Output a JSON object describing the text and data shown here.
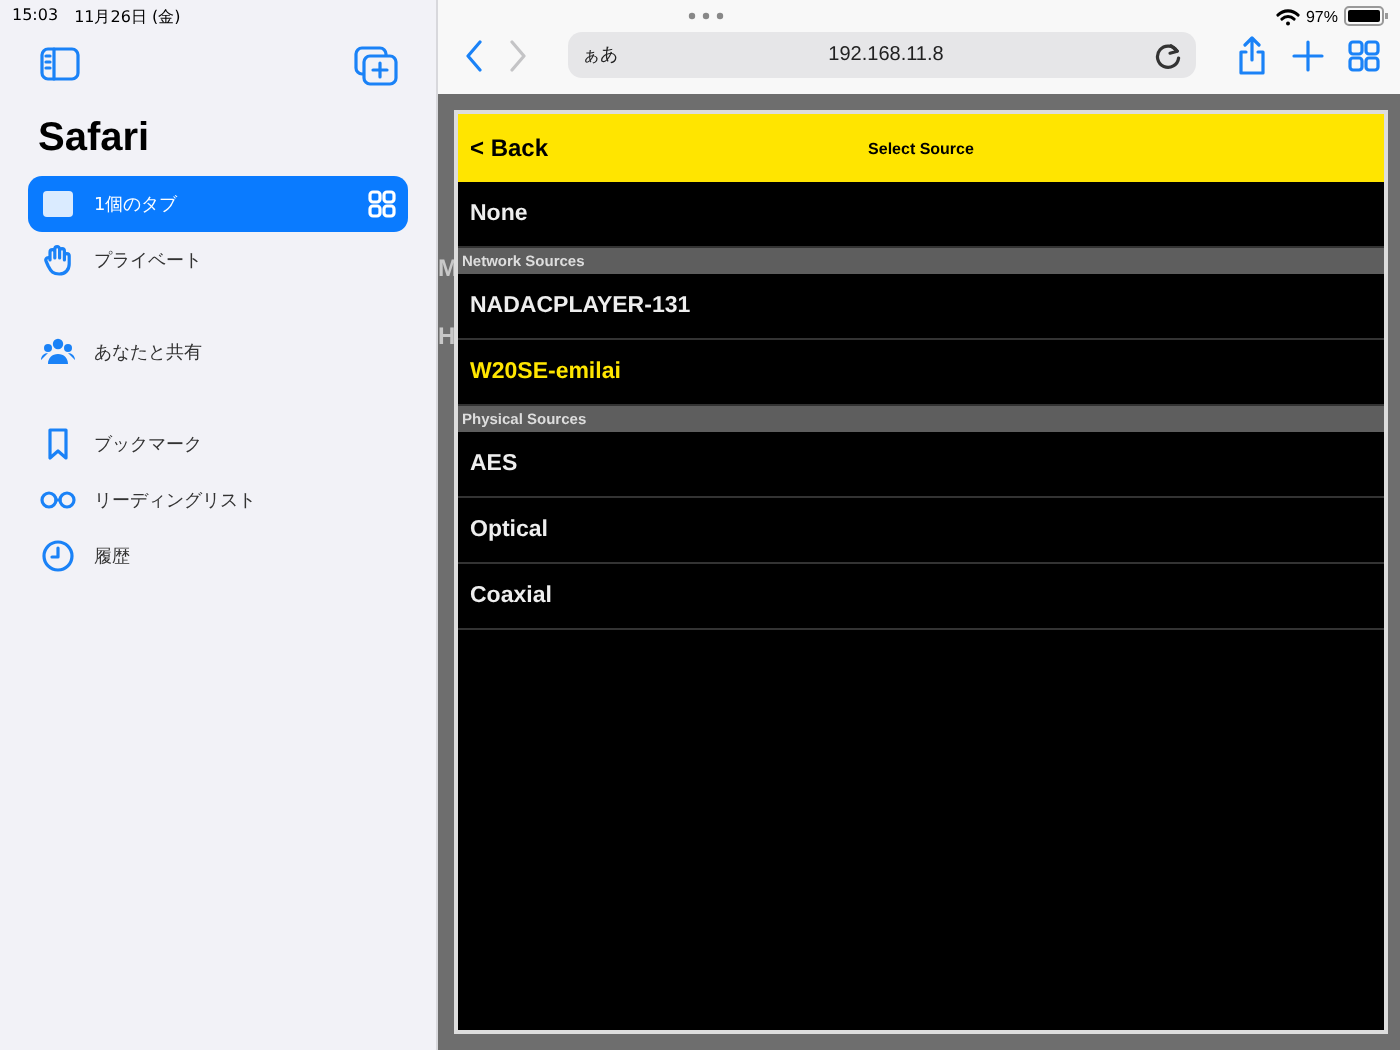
{
  "status_bar": {
    "time": "15:03",
    "date": "11月26日 (金)",
    "battery": "97%"
  },
  "sidebar": {
    "title": "Safari",
    "groups": [
      [
        {
          "label": "1個のタブ",
          "selected": true
        },
        {
          "label": "プライベート",
          "selected": false
        }
      ],
      [
        {
          "label": "あなたと共有",
          "selected": false
        }
      ],
      [
        {
          "label": "ブックマーク",
          "selected": false
        },
        {
          "label": "リーディングリスト",
          "selected": false
        },
        {
          "label": "履歴",
          "selected": false
        }
      ]
    ]
  },
  "address_bar": {
    "text_size": "ぁあ",
    "url": "192.168.11.8"
  },
  "background_letters": [
    "M",
    "H"
  ],
  "dialog": {
    "back": "< Back",
    "title": "Select Source",
    "items": [
      {
        "kind": "source",
        "label": "None",
        "selected": false
      },
      {
        "kind": "header",
        "label": "Network Sources"
      },
      {
        "kind": "source",
        "label": "NADACPLAYER-131",
        "selected": false
      },
      {
        "kind": "source",
        "label": "W20SE-emilai",
        "selected": true
      },
      {
        "kind": "header",
        "label": "Physical Sources"
      },
      {
        "kind": "source",
        "label": "AES",
        "selected": false
      },
      {
        "kind": "source",
        "label": "Optical",
        "selected": false
      },
      {
        "kind": "source",
        "label": "Coaxial",
        "selected": false
      }
    ]
  }
}
